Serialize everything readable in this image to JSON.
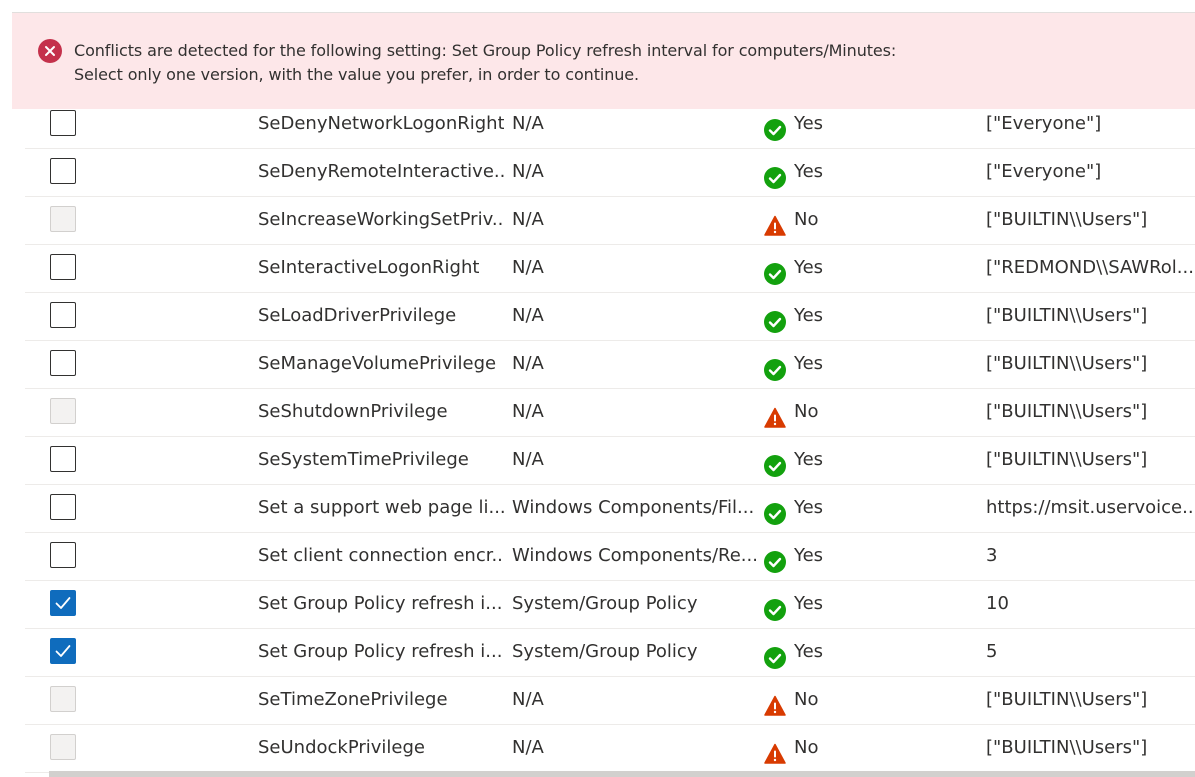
{
  "banner": {
    "line1": "Conflicts are detected for the following setting: Set Group Policy refresh interval for computers/Minutes:",
    "line2": "Select only one version, with the value you prefer, in order to continue.",
    "icon": "error-circle-icon",
    "color": "#c4314b",
    "background": "#fde7e9"
  },
  "rows": [
    {
      "name": "SeDenyNetworkLogonRight",
      "category": "N/A",
      "status": "Yes",
      "value": "[\"Everyone\"]",
      "checkbox": "unchecked"
    },
    {
      "name": "SeDenyRemoteInteractive...",
      "category": "N/A",
      "status": "Yes",
      "value": "[\"Everyone\"]",
      "checkbox": "unchecked"
    },
    {
      "name": "SeIncreaseWorkingSetPriv...",
      "category": "N/A",
      "status": "No",
      "value": "[\"BUILTIN\\\\Users\"]",
      "checkbox": "disabled"
    },
    {
      "name": "SeInteractiveLogonRight",
      "category": "N/A",
      "status": "Yes",
      "value": "[\"REDMOND\\\\SAWRol...",
      "checkbox": "unchecked"
    },
    {
      "name": "SeLoadDriverPrivilege",
      "category": "N/A",
      "status": "Yes",
      "value": "[\"BUILTIN\\\\Users\"]",
      "checkbox": "unchecked"
    },
    {
      "name": "SeManageVolumePrivilege",
      "category": "N/A",
      "status": "Yes",
      "value": "[\"BUILTIN\\\\Users\"]",
      "checkbox": "unchecked"
    },
    {
      "name": "SeShutdownPrivilege",
      "category": "N/A",
      "status": "No",
      "value": "[\"BUILTIN\\\\Users\"]",
      "checkbox": "disabled"
    },
    {
      "name": "SeSystemTimePrivilege",
      "category": "N/A",
      "status": "Yes",
      "value": "[\"BUILTIN\\\\Users\"]",
      "checkbox": "unchecked"
    },
    {
      "name": "Set a support web page li...",
      "category": "Windows Components/Fil...",
      "status": "Yes",
      "value": "https://msit.uservoice....",
      "checkbox": "unchecked"
    },
    {
      "name": "Set client connection encr...",
      "category": "Windows Components/Re...",
      "status": "Yes",
      "value": "3",
      "checkbox": "unchecked"
    },
    {
      "name": "Set Group Policy refresh i...",
      "category": "System/Group Policy",
      "status": "Yes",
      "value": "10",
      "checkbox": "checked"
    },
    {
      "name": "Set Group Policy refresh i...",
      "category": "System/Group Policy",
      "status": "Yes",
      "value": "5",
      "checkbox": "checked"
    },
    {
      "name": "SeTimeZonePrivilege",
      "category": "N/A",
      "status": "No",
      "value": "[\"BUILTIN\\\\Users\"]",
      "checkbox": "disabled"
    },
    {
      "name": "SeUndockPrivilege",
      "category": "N/A",
      "status": "No",
      "value": "[\"BUILTIN\\\\Users\"]",
      "checkbox": "disabled"
    }
  ],
  "colors": {
    "yes": "#13a10e",
    "no": "#d83b01",
    "checked": "#0f6cbd"
  },
  "icons": {
    "yes": "check-circle-icon",
    "no": "warning-triangle-icon",
    "checked": "checkmark-icon"
  }
}
